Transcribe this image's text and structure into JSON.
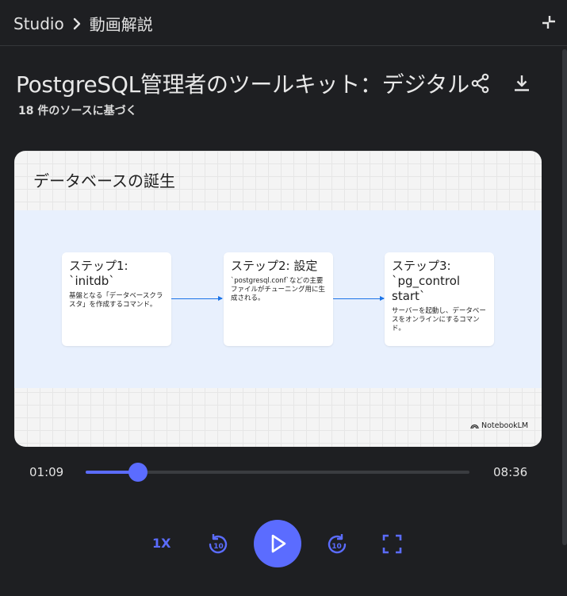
{
  "header": {
    "studio_label": "Studio",
    "section_label": "動画解説",
    "icons": {
      "separator": "chevron-right-icon",
      "collapse": "collapse-icon"
    }
  },
  "overview": {
    "title": "PostgreSQL管理者のツールキット：デジタル",
    "sources": "18 件のソースに基づく",
    "icons": {
      "share": "share-icon",
      "download": "download-icon"
    }
  },
  "slide": {
    "title": "データベースの誕生",
    "steps": [
      {
        "heading": "ステップ1:\n`initdb`",
        "text": "基盤となる「データベースクラスタ」を作成するコマンド。"
      },
      {
        "heading": "ステップ2: 設定",
        "text": "`postgresql.conf`などの主要ファイルがチューニング用に生成される。"
      },
      {
        "heading": "ステップ3:\n`pg_control\nstart`",
        "text": "サーバーを起動し、データベースをオンラインにするコマンド。"
      }
    ],
    "brand": "NotebookLM"
  },
  "player": {
    "current_time": "01:09",
    "total_time": "08:36",
    "progress": 0.137,
    "speed_label": "1X",
    "accent_color": "#5b6cff",
    "icons": {
      "rewind": "rewind-10-icon",
      "play": "play-icon",
      "forward": "forward-10-icon",
      "fullscreen": "fullscreen-icon"
    }
  }
}
